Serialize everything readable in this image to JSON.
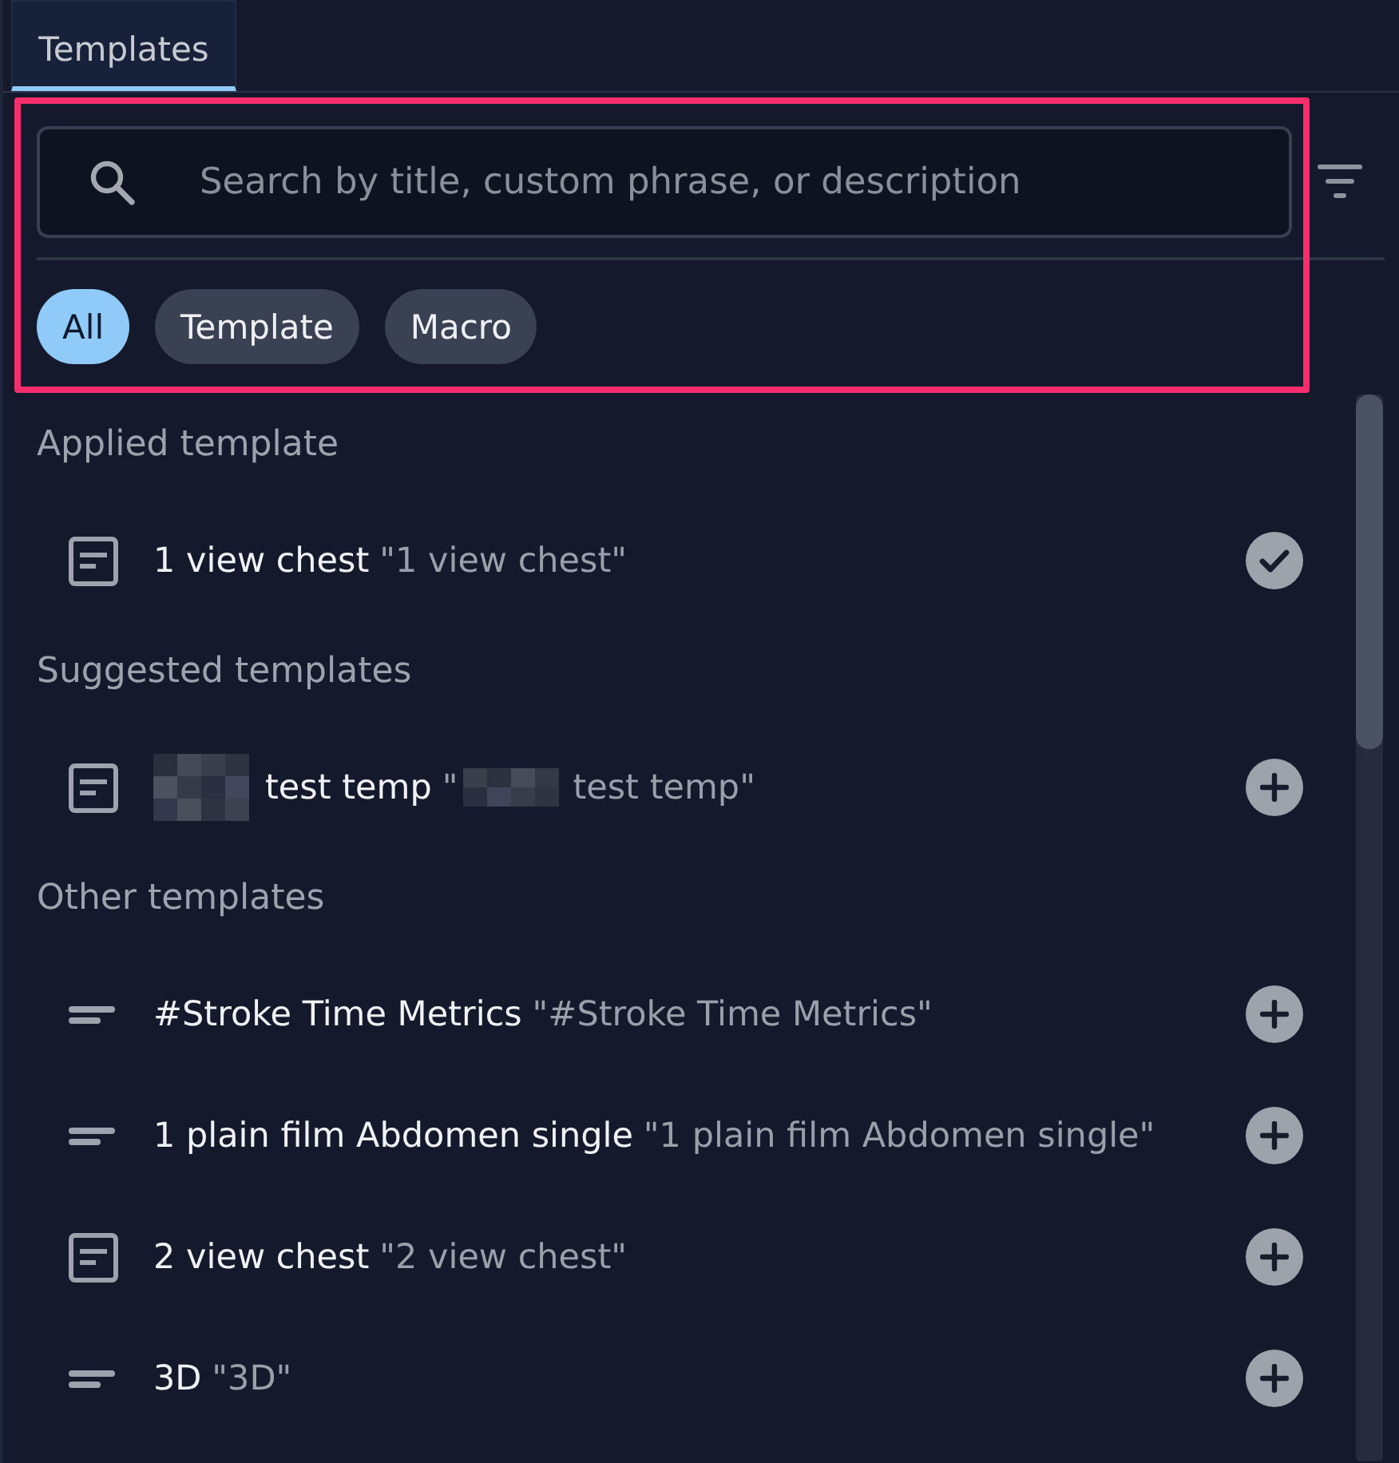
{
  "tabs": [
    {
      "label": "Templates",
      "selected": true
    }
  ],
  "filter_panel": {
    "highlighted": true,
    "search": {
      "placeholder": "Search by title, custom phrase, or description"
    },
    "chips": [
      {
        "label": "All",
        "selected": true
      },
      {
        "label": "Template",
        "selected": false
      },
      {
        "label": "Macro",
        "selected": false
      }
    ]
  },
  "sections": [
    {
      "title": "Applied template",
      "items": [
        {
          "kind": "template",
          "title": "1 view chest",
          "phrase": "\"1 view chest\"",
          "applied": true
        }
      ]
    },
    {
      "title": "Suggested templates",
      "items": [
        {
          "kind": "template",
          "redacted": true,
          "title": "test temp",
          "phrase_open": "\"",
          "phrase": "test temp\"",
          "applied": false
        }
      ]
    },
    {
      "title": "Other templates",
      "items": [
        {
          "kind": "macro",
          "title": "#Stroke Time Metrics",
          "phrase": "\"#Stroke Time Metrics\"",
          "applied": false
        },
        {
          "kind": "macro",
          "title": "1 plain film Abdomen single",
          "phrase": "\"1 plain film Abdomen single\"",
          "applied": false
        },
        {
          "kind": "template",
          "title": "2 view chest",
          "phrase": "\"2 view chest\"",
          "applied": false
        },
        {
          "kind": "macro",
          "title": "3D",
          "phrase": "\"3D\"",
          "applied": false
        }
      ]
    }
  ]
}
